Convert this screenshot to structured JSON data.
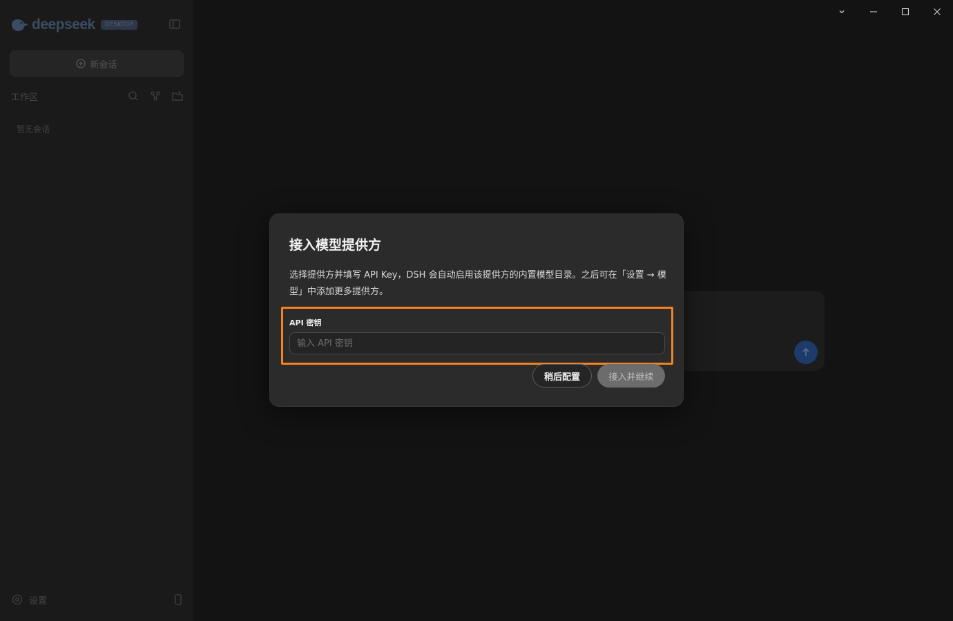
{
  "app": {
    "brand_name": "deepseek",
    "brand_badge": "DESKTOP",
    "new_chat_label": "新会话",
    "section_title": "工作区",
    "empty_hint": "暂无会话",
    "settings_label": "设置",
    "accent_color": "#f58220"
  },
  "icons": {
    "logo": "deepseek-whale-icon",
    "collapse": "sidebar-collapse-icon",
    "new_chat": "plus-circle-icon",
    "search": "search-icon",
    "graph": "graph-icon",
    "new_folder": "new-folder-icon",
    "settings": "gear-icon",
    "phone": "phone-icon",
    "send": "arrow-up-icon"
  },
  "window": {
    "controls": [
      "chevron-down",
      "minimize",
      "maximize",
      "close"
    ]
  },
  "modal": {
    "title": "接入模型提供方",
    "description": "选择提供方并填写 API Key，DSH 会自动启用该提供方的内置模型目录。之后可在「设置 → 模型」中添加更多提供方。",
    "field_label": "API 密钥",
    "field_placeholder": "输入 API 密钥",
    "field_value": "",
    "later_button": "稍后配置",
    "connect_button": "接入并继续"
  }
}
